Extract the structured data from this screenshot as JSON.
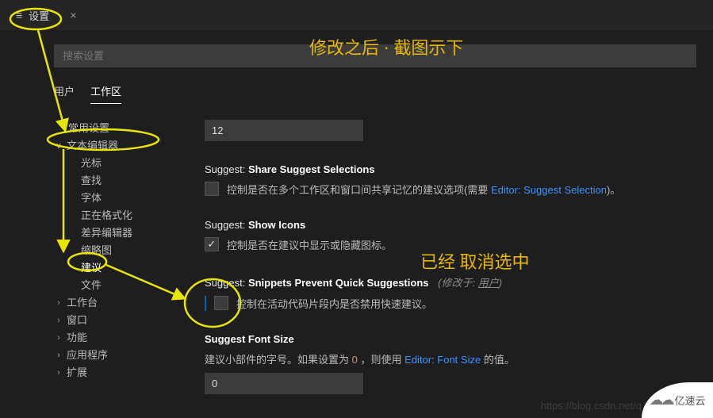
{
  "tab": {
    "icon": "≡",
    "title": "设置",
    "close": "×"
  },
  "search": {
    "placeholder": "搜索设置"
  },
  "scope": {
    "user": "用户",
    "workspace": "工作区"
  },
  "tree": {
    "common": "常用设置",
    "texteditor": "文本编辑器",
    "sub": {
      "cursor": "光标",
      "find": "查找",
      "font": "字体",
      "formatting": "正在格式化",
      "diff": "差异编辑器",
      "minimap": "缩略图",
      "suggest": "建议",
      "files": "文件"
    },
    "workbench": "工作台",
    "window": "窗口",
    "features": "功能",
    "application": "应用程序",
    "extensions": "扩展"
  },
  "settings": {
    "topValue": "12",
    "share": {
      "title_prefix": "Suggest: ",
      "title_name": "Share Suggest Selections",
      "desc_a": "控制是否在多个工作区和窗口间共享记忆的建议选项(需要 ",
      "link": "Editor: Suggest Selection",
      "desc_b": ")。",
      "checked": false
    },
    "icons": {
      "title_prefix": "Suggest: ",
      "title_name": "Show Icons",
      "desc": "控制是否在建议中显示或隐藏图标。",
      "checked": true
    },
    "snippets": {
      "title_prefix": "Suggest: ",
      "title_name": "Snippets Prevent Quick Suggestions",
      "desc": "控制在活动代码片段内是否禁用快速建议。",
      "checked": false,
      "scope_a": "(修改于: ",
      "scope_u": "用户",
      "scope_b": ")"
    },
    "fontsize": {
      "title": "Suggest Font Size",
      "desc_a": "建议小部件的字号。如果设置为 ",
      "zero": "0",
      "desc_b": " ，则使用 ",
      "link": "Editor: Font Size",
      "desc_c": " 的值。",
      "value": "0"
    }
  },
  "annotations": {
    "top": "修改之后  ·  截图示下",
    "right": "已经  取消选中"
  },
  "footer": {
    "watermark": "https://blog.csdn.net/q",
    "logo_text": "亿速云"
  }
}
